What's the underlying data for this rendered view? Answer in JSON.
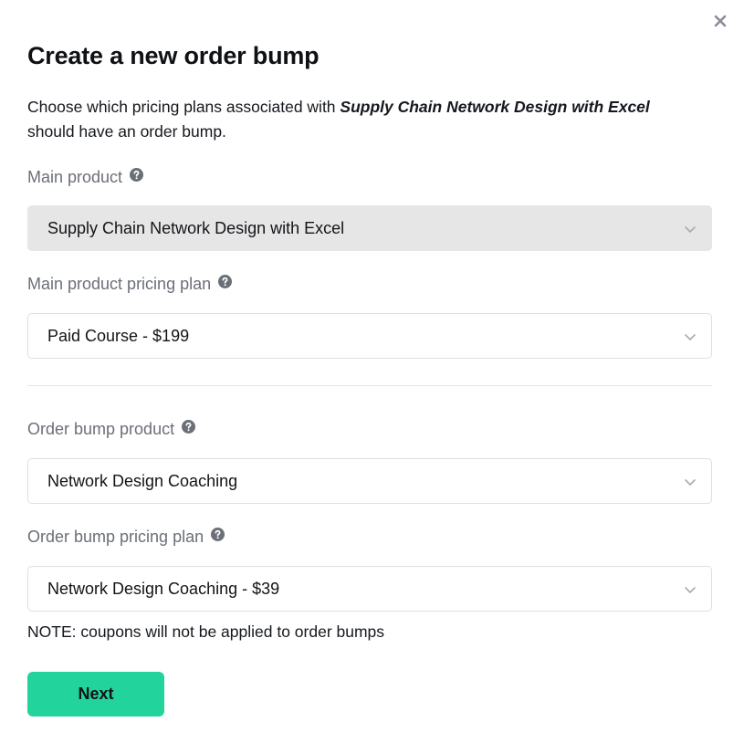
{
  "modal": {
    "title": "Create a new order bump",
    "intro_prefix": "Choose which pricing plans associated with ",
    "intro_product": "Supply Chain Network Design with Excel",
    "intro_suffix": "should have an order bump."
  },
  "fields": {
    "main_product": {
      "label": "Main product",
      "value": "Supply Chain Network Design with Excel",
      "disabled": true
    },
    "main_product_plan": {
      "label": "Main product pricing plan",
      "value": "Paid Course - $199"
    },
    "bump_product": {
      "label": "Order bump product",
      "value": "Network Design Coaching"
    },
    "bump_plan": {
      "label": "Order bump pricing plan",
      "value": "Network Design Coaching - $39"
    }
  },
  "note": "NOTE: coupons will not be applied to order bumps",
  "actions": {
    "next_label": "Next"
  },
  "icons": {
    "close": "close-icon",
    "help": "question-circle-icon",
    "dropdown": "chevron-down-icon"
  },
  "colors": {
    "primary": "#22d39b",
    "label": "#6b6f78",
    "disabled_bg": "#e6e6e6",
    "border": "#dcdfe4"
  }
}
